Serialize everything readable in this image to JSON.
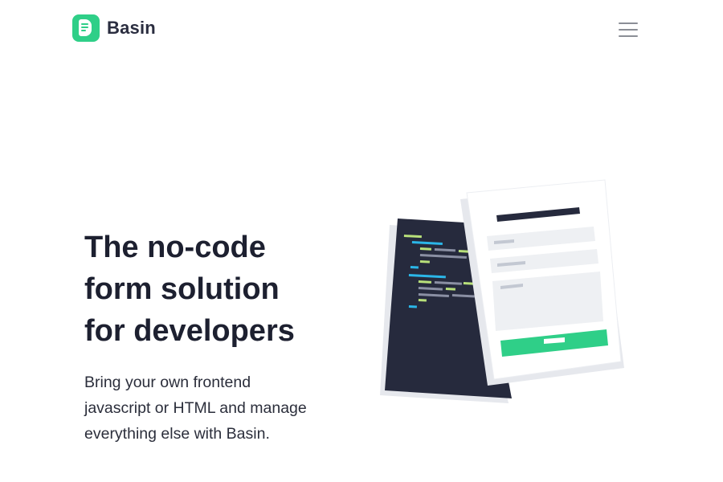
{
  "header": {
    "brand_name": "Basin",
    "logo_icon": "basin-logo-icon",
    "menu_icon": "hamburger-menu-icon"
  },
  "hero": {
    "title_lines": [
      "The no-code",
      "form solution",
      "for developers"
    ],
    "subtitle": "Bring your own frontend javascript or HTML and manage everything else with Basin."
  },
  "illustration": {
    "code_panel_icon": "code-editor-illustration",
    "form_panel_icon": "form-illustration"
  },
  "colors": {
    "brand_green": "#2fcf88",
    "text_dark": "#1d2030",
    "code_bg": "#262a3d",
    "menu_gray": "#8b8e96"
  }
}
